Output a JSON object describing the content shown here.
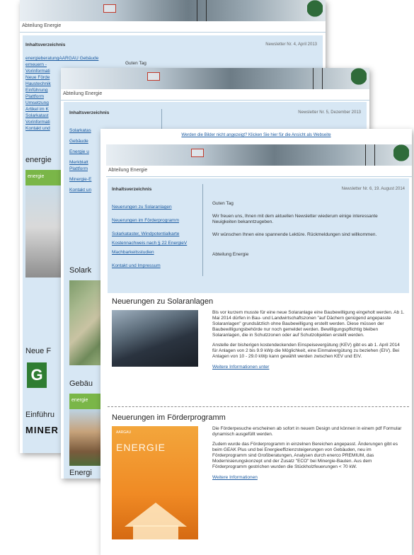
{
  "pages": {
    "back": {
      "department": "Abteilung  Energie",
      "toc_title": "Inhaltsverzeichnis",
      "newsletter_no": "Newsletter Nr. 4, April 2013",
      "greeting": "Guten Tag",
      "links": [
        "energieberatungAARGAU Gebäude",
        "erneuern - ",
        "Vorinformati",
        "Neue Förde",
        "Haustechnik",
        "Einführung",
        "Plattform",
        "Umsetzung",
        "Artikel im K",
        "Solarkatast",
        "Vorinformati",
        "Kontakt und"
      ],
      "side_heading": "energie",
      "badge": "energie",
      "new_heading": "Neue F",
      "intro_heading": "Einführu",
      "minergie": "MINER"
    },
    "middle": {
      "department": "Abteilung  Energie",
      "toc_title": "Inhaltsverzeichnis",
      "newsletter_no": "Newsletter Nr. 5, Dezember 2013",
      "links": [
        "Solarkatas",
        "Gebäude",
        "Energie u",
        "Merkblatt",
        "Plattform",
        "Minergie-E",
        "Kontakt un"
      ],
      "solar_heading": "Solark",
      "building_heading": "Gebäu",
      "badge": "energie",
      "energy_heading": "Energi"
    },
    "front": {
      "web_notice": "Werden die Bilder nicht angezeigt? Klicken Sie hier für die Ansicht als Webseite",
      "department": "Abteilung  Energie",
      "toc_title": "Inhaltsverzeichnis",
      "newsletter_no": "Newsletter Nr. 6, 19. August 2014",
      "links": [
        "Neuerungen zu Solaranlagen",
        "Neuerungen im Förderprogramm",
        "Solarkataster, Windpotentialkarte",
        "Kostennachweis nach § 22 EnergieV",
        "Machbarkeitsstudien",
        "Kontakt und Impressum"
      ],
      "greeting": "Guten Tag",
      "intro": "Wir freuen uns, Ihnen mit dem aktuellen Newsletter wiederum einige interessante Neuigkeiten bekanntzugeben.",
      "wish": "Wir wünschen Ihnen eine spannende Lektüre. Rückmeldungen sind willkommen.",
      "signature": "Abteilung Energie",
      "section1": {
        "title": "Neuerungen zu Solaranlagen",
        "para1": "Bis vor kurzem musste für eine neue Solaranlage eine Baubewilligung eingeholt werden. Ab 1. Mai 2014 dürfen in Bau- und Landwirtschaftszonen \"auf Dächern genügend angepasste Solaranlagen\" grundsätzlich ohne Baubewilligung erstellt werden. Diese müssen der Baubewilligungsbehörde nur noch gemeldet werden. Bewilligungspflichtig bleiben Solaranlagen, die in Schutzzonen oder auf Schutzobjekten erstellt werden.",
        "para2": "Anstelle der bisherigen kostendeckenden Einspeisevergütung (KEV) gibt es ab 1. April 2014 für Anlagen von 2 bis 9.9 kWp die Möglichkeit, eine Einmalvergütung zu beziehen (EIV). Bei Anlagen von 10 - 29.0 kWp kann gewählt werden zwischen KEV und EIV.",
        "more": "Weitere Informationen unter"
      },
      "section2": {
        "title": "Neuerungen im Förderprogramm",
        "para1": "Die Förderpesuche erscheinen ab sofort in neuem Design und können in einem pdf Formular dynamisch ausgefüllt werden.",
        "para2": "Zudem wurde das Förderprogramm in einzelnen Bereichen angepasst. Änderungen gibt es beim GEAK Plus und bei Energieeffizienzsteigerungen von Gebäuden, neu im Förderprogramm sind Großberatungen, Analysen durch enerco PREMIUM, das Modernisierungskonzept und der Zusatz \"ECO\" bei Minergie-Bauten. Aus dem Förderprogramm gestrichen wurden die Stückholzfeuerungen < 70 kW.",
        "more": "Weitere Informationen",
        "cover_title": "ENERGIE",
        "cover_small": "AARGAU"
      }
    }
  },
  "colors": {
    "panel_blue": "#d7e7f4",
    "link_blue": "#1a5aa0",
    "energie_green": "#7ab648",
    "cover_orange": "#f08a24"
  }
}
